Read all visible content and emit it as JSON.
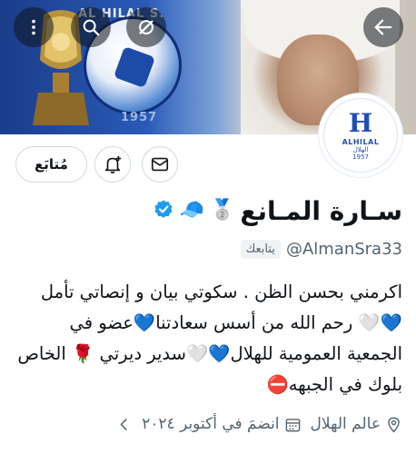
{
  "banner": {
    "club_text": "AL HILAL S.",
    "year": "1957"
  },
  "avatar": {
    "logo": "H",
    "name_en": "ALHILAL",
    "name_ar": "الهلال",
    "year": "1957"
  },
  "actions": {
    "follow_label": "مُتابَع"
  },
  "profile": {
    "display_name": "سـارة المـانع",
    "emoji_medal": "🥈",
    "emoji_cap": "🧢",
    "handle": "@AlmanSra33",
    "follows_you": "يتابعك",
    "bio": "اكرمني بحسن الظن . سكوتي بيان و إنصاتي تأمل 💙🤍 رحم الله من أسس سعادتنا💙عضو في الجمعية العمومية للهلال💙🤍سدير ديرتي 🌹 الخاص بلوك في الجبهه⛔"
  },
  "meta": {
    "location": "عالم الهلال",
    "joined": "انضمَ في أكتوبر ٢٠٢٤"
  },
  "colors": {
    "accent": "#1d9bf0",
    "muted": "#536471",
    "hilal_blue": "#1f4fb5"
  }
}
